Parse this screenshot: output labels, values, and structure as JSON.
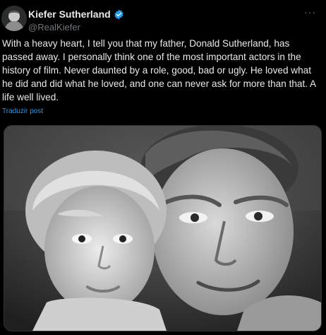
{
  "user": {
    "display_name": "Kiefer Sutherland",
    "handle": "@RealKiefer",
    "verified": true
  },
  "post": {
    "text": "With a heavy heart, I tell you that my father, Donald Sutherland, has passed away. I personally think one of the most important actors in the history of film. Never daunted by a role, good, bad or ugly. He loved what he did and did what he loved, and one can never ask for more than that. A life well lived.",
    "translate_label": "Traduzir post"
  },
  "actions": {
    "more_label": "···"
  },
  "media": {
    "type": "black-and-white-photo"
  },
  "colors": {
    "background": "#000000",
    "text": "#e7e9ea",
    "muted": "#71767b",
    "accent": "#1d9bf0"
  },
  "icons": {
    "verified": "verified-badge-icon",
    "more": "more-options-icon"
  }
}
